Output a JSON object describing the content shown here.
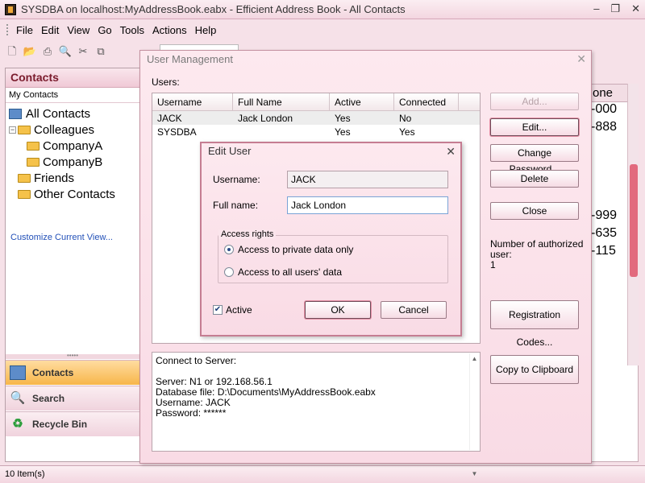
{
  "window": {
    "title": "SYSDBA on localhost:MyAddressBook.eabx - Efficient Address Book - All Contacts"
  },
  "menu": [
    "File",
    "Edit",
    "View",
    "Go",
    "Tools",
    "Actions",
    "Help"
  ],
  "sidebar": {
    "header": "Contacts",
    "subheader": "My Contacts",
    "tree": [
      {
        "label": "All Contacts"
      },
      {
        "label": "Colleagues"
      },
      {
        "label": "CompanyA"
      },
      {
        "label": "CompanyB"
      },
      {
        "label": "Friends"
      },
      {
        "label": "Other Contacts"
      }
    ],
    "customize": "Customize Current View...",
    "nav": [
      "Contacts",
      "Search",
      "Recycle Bin"
    ]
  },
  "background_list": {
    "column": "one",
    "cells": [
      "-000",
      "-888",
      "",
      "",
      "",
      "",
      "-999",
      "-635",
      "-115"
    ]
  },
  "status": {
    "items": "10 Item(s)"
  },
  "user_management": {
    "title": "User Management",
    "users_label": "Users:",
    "columns": [
      "Username",
      "Full Name",
      "Active",
      "Connected"
    ],
    "rows": [
      {
        "username": "JACK",
        "full_name": "Jack London",
        "active": "Yes",
        "connected": "No"
      },
      {
        "username": "SYSDBA",
        "full_name": "",
        "active": "Yes",
        "connected": "Yes"
      }
    ],
    "buttons": {
      "add": "Add...",
      "edit": "Edit...",
      "change_password": "Change Password...",
      "delete": "Delete",
      "close": "Close",
      "registration_codes": "Registration Codes...",
      "copy_clipboard": "Copy to Clipboard"
    },
    "authorized_label": "Number of authorized user:",
    "authorized_count": "1",
    "connect_info": [
      "Connect to Server:",
      "",
      "Server: N1 or 192.168.56.1",
      "Database file: D:\\Documents\\MyAddressBook.eabx",
      "Username: JACK",
      "Password: ******"
    ]
  },
  "edit_user": {
    "title": "Edit User",
    "username_label": "Username:",
    "username_value": "JACK",
    "fullname_label": "Full name:",
    "fullname_value": "Jack London",
    "access_group": "Access rights",
    "access_private": "Access to private data only",
    "access_all": "Access to all users' data",
    "active_label": "Active",
    "ok": "OK",
    "cancel": "Cancel"
  }
}
